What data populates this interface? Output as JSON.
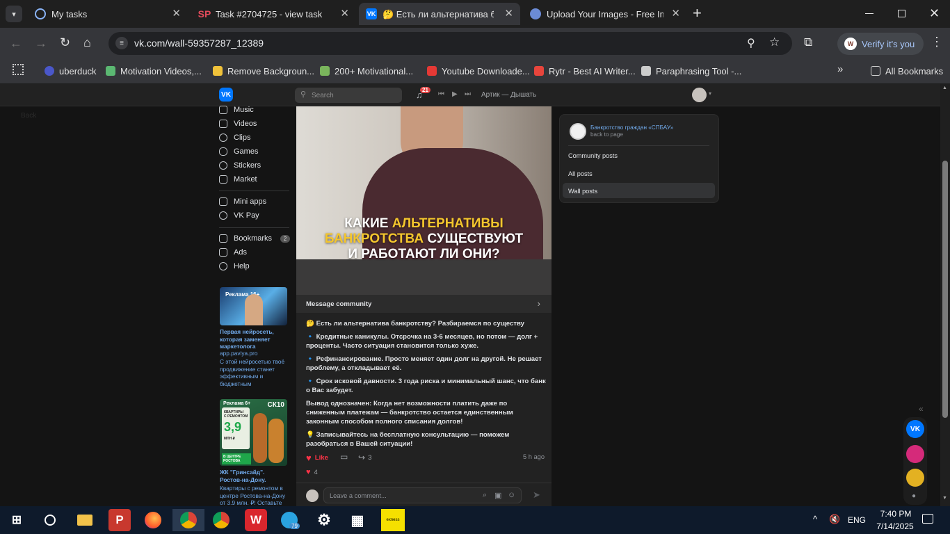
{
  "browser": {
    "tabs": [
      {
        "title": "My tasks",
        "icon": "target-icon"
      },
      {
        "title": "Task #2704725 - view task",
        "icon": "sp-logo-icon"
      },
      {
        "title": "🤔 Есть ли альтернатива банкротства",
        "icon": "vk-icon"
      },
      {
        "title": "Upload Your Images - Free Image Hosting",
        "icon": "image-host-icon"
      }
    ],
    "url": "vk.com/wall-59357287_12389",
    "verify_label": "Verify it's you",
    "profile_letter": "W",
    "bookmarks": [
      "uberduck",
      "Motivation Videos,...",
      "Remove Backgroun...",
      "200+ Motivational...",
      "Youtube Downloade...",
      "Rytr - Best AI Writer...",
      "Paraphrasing Tool -..."
    ],
    "all_bookmarks": "All Bookmarks"
  },
  "vk": {
    "logo": "VK",
    "search_placeholder": "Search",
    "notifications": "21",
    "now_playing": "Артик — Дышать",
    "nav": [
      "Music",
      "Videos",
      "Clips",
      "Games",
      "Stickers",
      "Market"
    ],
    "nav2": [
      "Mini apps",
      "VK Pay"
    ],
    "nav3": [
      "Bookmarks",
      "Ads",
      "Help"
    ],
    "bookmarks_count": "2",
    "ads": [
      {
        "badge": "Реклама 16+",
        "title": "Первая нейросеть, которая заменяет маркетолога",
        "domain": "app.paviya.pro",
        "desc": "С этой нейросетью твоё продвижение станет эффективным и бюджетным"
      },
      {
        "badge": "Реклама 6+",
        "title": "ЖК \"Гринсайд\". Ростов-на-Дону.",
        "domain": "",
        "desc": "Квартиры с ремонтом в центре Ростова-на-Дону от 3.9 млн. ₽! Оставьте"
      }
    ],
    "ad2_image": {
      "brand": "СК10",
      "line1": "КВАРТИРЫ",
      "line2": "С РЕМОНТОМ",
      "price": "3,9",
      "unit": "МЛН ₽",
      "location": "В ЦЕНТРЕ РОСТОВА"
    },
    "post": {
      "image_headline": {
        "l1a": "КАКИЕ",
        "l1b": "АЛЬТЕРНАТИВЫ",
        "l2a": "БАНКРОТСТВА",
        "l2b": "СУЩЕСТВУЮТ",
        "l3": "И РАБОТАЮТ ЛИ ОНИ?"
      },
      "message_community": "Message community",
      "paragraphs": [
        "🤔 Есть ли альтернатива банкротству? Разбираемся по существу",
        "🔹 Кредитные каникулы. Отсрочка на 3-6 месяцев, но потом — долг + проценты. Часто ситуация становится только хуже.",
        "🔹 Рефинансирование. Просто меняет один долг на другой. Не решает проблему, а откладывает её.",
        "🔹 Срок исковой давности. 3 года риска и минимальный шанс, что банк о Вас забудет.",
        "Вывод однозначен: Когда нет возможности платить даже по сниженным платежам — банкротство остается единственным законным способом полного списания долгов!",
        "💡 Записывайтесь на бесплатную консультацию — поможем разобраться в Вашей ситуации!"
      ],
      "like_label": "Like",
      "share_count": "3",
      "time": "5 h ago",
      "likes_count": "4",
      "comment_placeholder": "Leave a comment..."
    },
    "side": {
      "community": "Банкротство граждан «СПБАУ»",
      "back": "back to page",
      "items": [
        "Community posts",
        "All posts",
        "Wall posts"
      ]
    },
    "bottom_back": "Back"
  },
  "taskbar": {
    "time": "7:40 PM",
    "date": "7/14/2025",
    "lang": "ENG",
    "telegram_badge": "79",
    "exness": "exness"
  },
  "colors": {
    "vk_blue": "#0077ff",
    "accent": "#71aaeb",
    "headline_yellow": "#f4c62d",
    "like_red": "#ff3347"
  }
}
